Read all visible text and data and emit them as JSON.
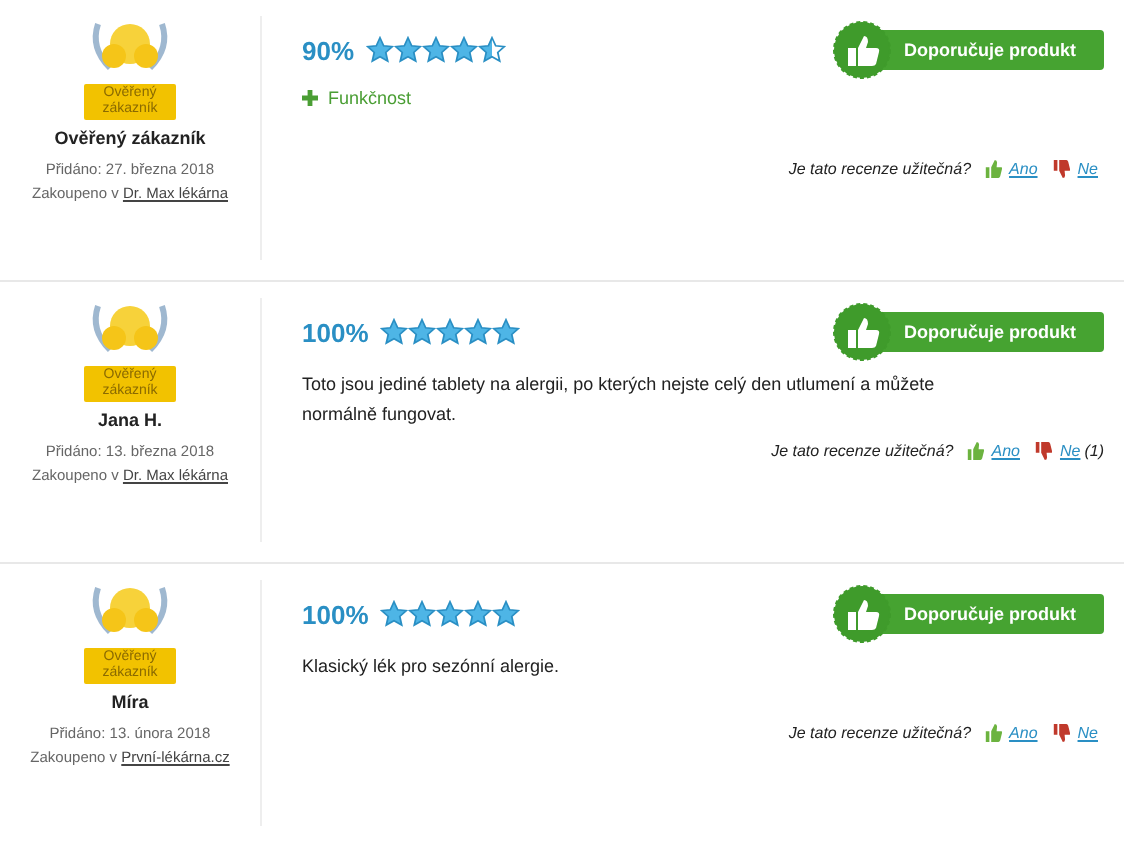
{
  "reviews": [
    {
      "badge_text": "Ověřený zákazník",
      "author": "Ověřený zákazník",
      "date": "Přidáno: 27. března 2018",
      "purchased_prefix": "Zakoupeno v",
      "store": "Dr. Max lékárna",
      "percent": "90%",
      "stars": 4.5,
      "recommend": "Doporučuje produkt",
      "pros": [
        "Funkčnost"
      ],
      "helpful": {
        "question": "Je tato recenze užitečná?",
        "yes": "Ano",
        "no": "Ne"
      }
    },
    {
      "badge_text": "Ověřený zákazník",
      "author": "Jana H.",
      "date": "Přidáno: 13. března 2018",
      "purchased_prefix": "Zakoupeno v",
      "store": "Dr. Max lékárna",
      "percent": "100%",
      "stars": 5,
      "recommend": "Doporučuje produkt",
      "text": "Toto jsou jediné tablety na alergii, po kterých nejste celý den utlumení a můžete normálně fungovat.",
      "helpful": {
        "question": "Je tato recenze užitečná?",
        "yes": "Ano",
        "no": "Ne",
        "no_count": "(1)"
      }
    },
    {
      "badge_text": "Ověřený zákazník",
      "author": "Míra",
      "date": "Přidáno: 13. února 2018",
      "purchased_prefix": "Zakoupeno v",
      "store": "První-lékárna.cz",
      "percent": "100%",
      "stars": 5,
      "recommend": "Doporučuje produkt",
      "text": "Klasický lék pro sezónní alergie.",
      "helpful": {
        "question": "Je tato recenze užitečná?",
        "yes": "Ano",
        "no": "Ne"
      }
    }
  ]
}
